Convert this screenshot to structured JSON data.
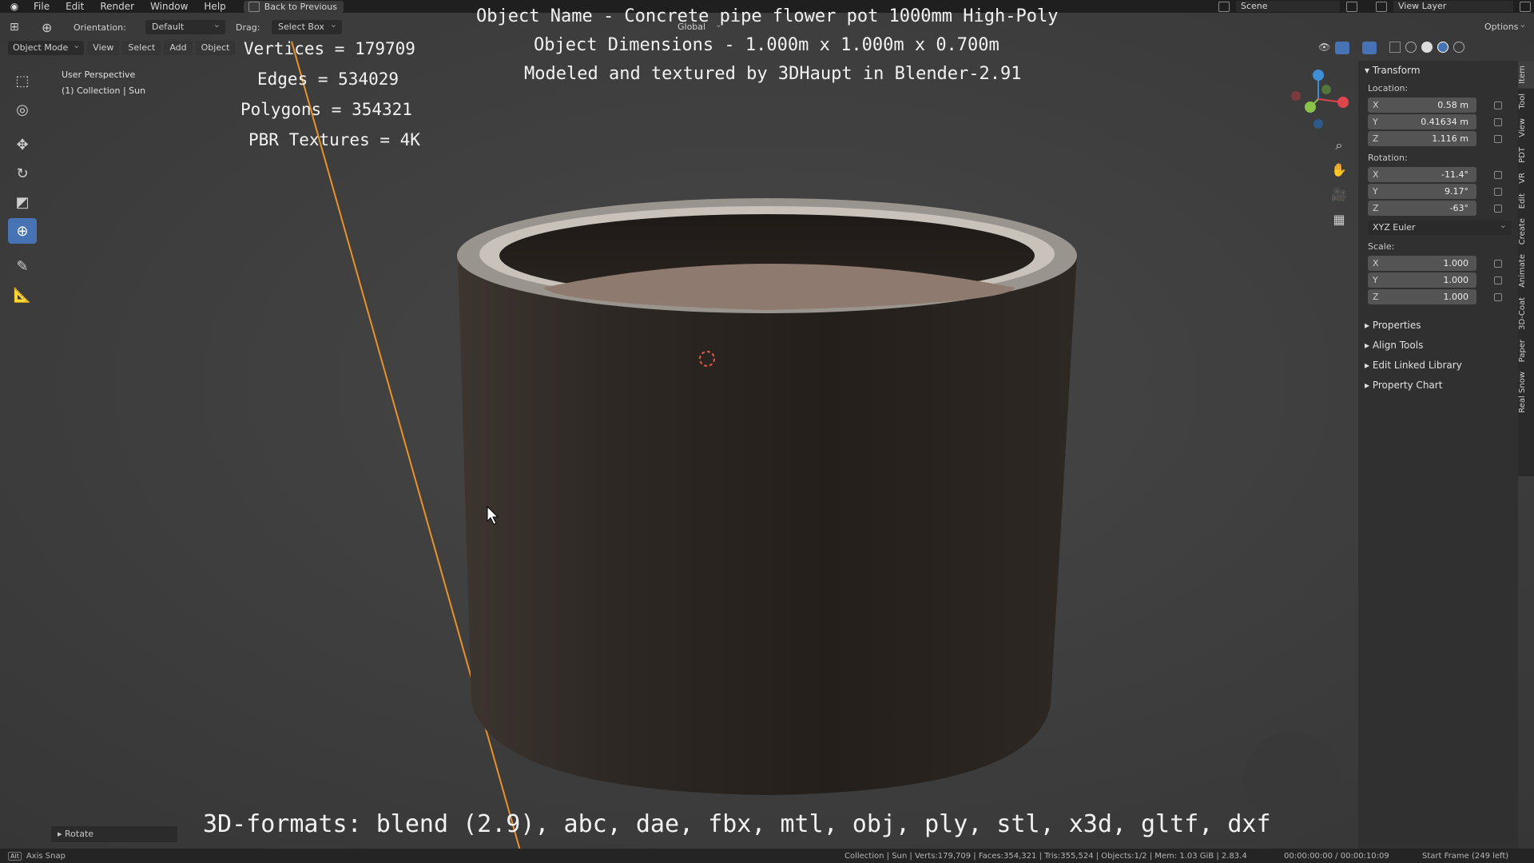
{
  "menu": {
    "items": [
      "File",
      "Edit",
      "Render",
      "Window",
      "Help"
    ],
    "back_button": "Back to Previous",
    "scene": "Scene",
    "view_layer": "View Layer"
  },
  "header": {
    "orientation_label": "Orientation:",
    "orientation_value": "Default",
    "drag_label": "Drag:",
    "drag_value": "Select Box",
    "transform_space": "Global",
    "options": "Options"
  },
  "mode_bar": {
    "mode": "Object Mode",
    "menus": [
      "View",
      "Select",
      "Add",
      "Object"
    ]
  },
  "viewport": {
    "perspective": "User Perspective",
    "collection": "(1) Collection | Sun"
  },
  "overlay": {
    "title_line1": "Object Name - Concrete pipe flower pot 1000mm High-Poly",
    "title_line2": "Object Dimensions -  1.000m x 1.000m x 0.700m",
    "title_line3": "Modeled and textured by 3DHaupt in Blender-2.91",
    "vertices": "Vertices = 179709",
    "edges": "Edges = 534029",
    "polygons": "Polygons = 354321",
    "textures": "PBR Textures = 4K",
    "formats": "3D-formats: blend (2.9), abc, dae, fbx, mtl, obj, ply, stl, x3d, gltf, dxf"
  },
  "sidebar": {
    "transform_title": "Transform",
    "location_label": "Location:",
    "location": [
      {
        "axis": "X",
        "value": "0.58 m"
      },
      {
        "axis": "Y",
        "value": "0.41634 m"
      },
      {
        "axis": "Z",
        "value": "1.116 m"
      }
    ],
    "rotation_label": "Rotation:",
    "rotation": [
      {
        "axis": "X",
        "value": "-11.4°"
      },
      {
        "axis": "Y",
        "value": "9.17°"
      },
      {
        "axis": "Z",
        "value": "-63°"
      }
    ],
    "rotation_mode": "XYZ Euler",
    "scale_label": "Scale:",
    "scale": [
      {
        "axis": "X",
        "value": "1.000"
      },
      {
        "axis": "Y",
        "value": "1.000"
      },
      {
        "axis": "Z",
        "value": "1.000"
      }
    ],
    "panels": [
      "Properties",
      "Align Tools",
      "Edit Linked Library",
      "Property Chart"
    ],
    "tabs": [
      "Item",
      "Tool",
      "View",
      "PDT",
      "VR",
      "Edit",
      "Create",
      "Animate",
      "3D-Coat",
      "Paper",
      "Real Snow"
    ]
  },
  "operator_panel": "Rotate",
  "statusbar": {
    "key": "Alt",
    "hint": "Axis Snap",
    "stats": "Collection | Sun | Verts:179,709 | Faces:354,321 | Tris:355,524 | Objects:1/2 | Mem: 1.03 GiB | 2.83.4",
    "time": "00:00:00:00 / 00:00:10:09",
    "frames": "Start Frame (249 left)"
  },
  "colors": {
    "accent": "#4772b3",
    "viewport_bg": "#3d3d3d",
    "gizmo_x": "#e0454f",
    "gizmo_y": "#8bc34a",
    "gizmo_z": "#3f8fd6"
  }
}
